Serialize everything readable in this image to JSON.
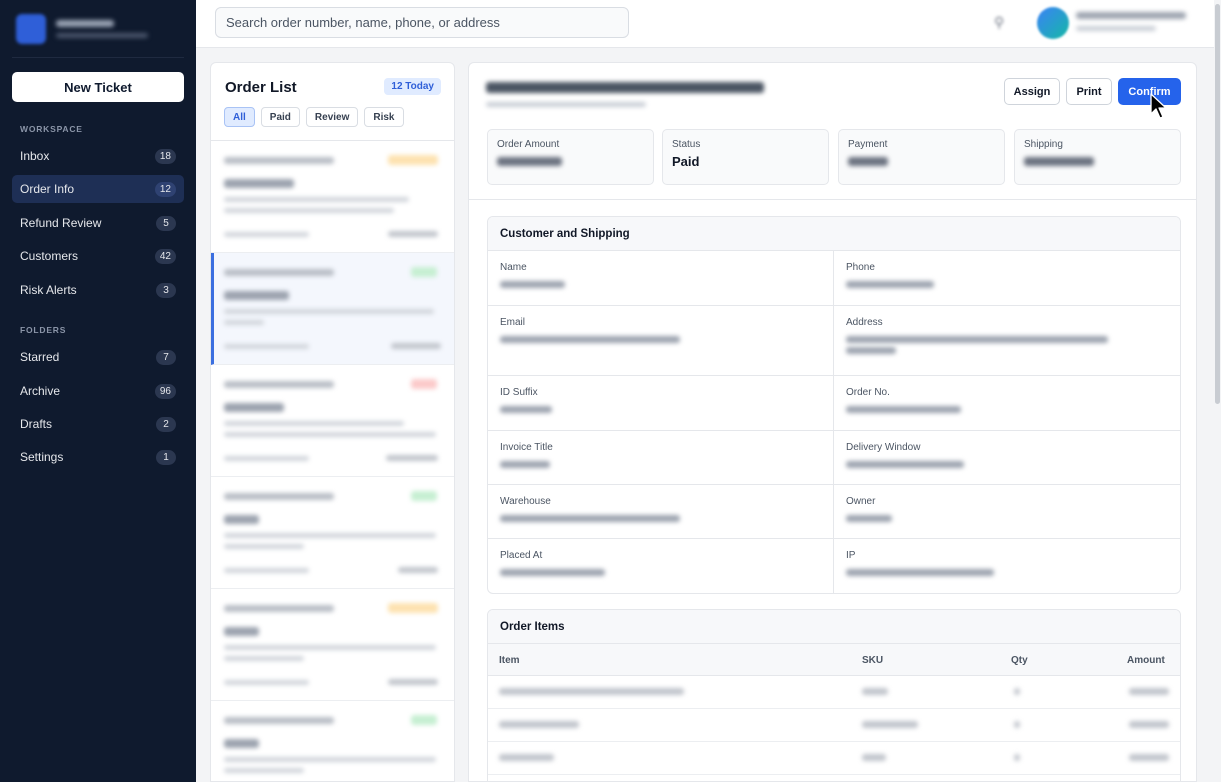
{
  "sidebar": {
    "new_ticket_label": "New Ticket",
    "workspace_label": "WORKSPACE",
    "folders_label": "FOLDERS",
    "workspace_items": [
      {
        "label": "Inbox",
        "count": "18"
      },
      {
        "label": "Order Info",
        "count": "12"
      },
      {
        "label": "Refund Review",
        "count": "5"
      },
      {
        "label": "Customers",
        "count": "42"
      },
      {
        "label": "Risk Alerts",
        "count": "3"
      }
    ],
    "folder_items": [
      {
        "label": "Starred",
        "count": "7"
      },
      {
        "label": "Archive",
        "count": "96"
      },
      {
        "label": "Drafts",
        "count": "2"
      },
      {
        "label": "Settings",
        "count": "1"
      }
    ]
  },
  "topbar": {
    "search_placeholder": "Search order number, name, phone, or address"
  },
  "order_list": {
    "title": "Order List",
    "today_badge": "12 Today",
    "filters": [
      "All",
      "Paid",
      "Review",
      "Risk"
    ]
  },
  "detail": {
    "actions": {
      "assign": "Assign",
      "print": "Print",
      "confirm": "Confirm"
    },
    "stats": {
      "order_amount_label": "Order Amount",
      "status_label": "Status",
      "status_value": "Paid",
      "payment_label": "Payment",
      "shipping_label": "Shipping"
    },
    "customer_section": {
      "title": "Customer and Shipping",
      "fields": [
        "Name",
        "Phone",
        "Email",
        "Address",
        "ID Suffix",
        "Order No.",
        "Invoice Title",
        "Delivery Window",
        "Warehouse",
        "Owner",
        "Placed At",
        "IP"
      ]
    },
    "items_section": {
      "title": "Order Items",
      "columns": {
        "item": "Item",
        "sku": "SKU",
        "qty": "Qty",
        "amount": "Amount"
      }
    }
  },
  "colors": {
    "sidebar_bg": "#0f1a2e",
    "accent": "#2563eb",
    "active_nav": "#1e2f55"
  }
}
